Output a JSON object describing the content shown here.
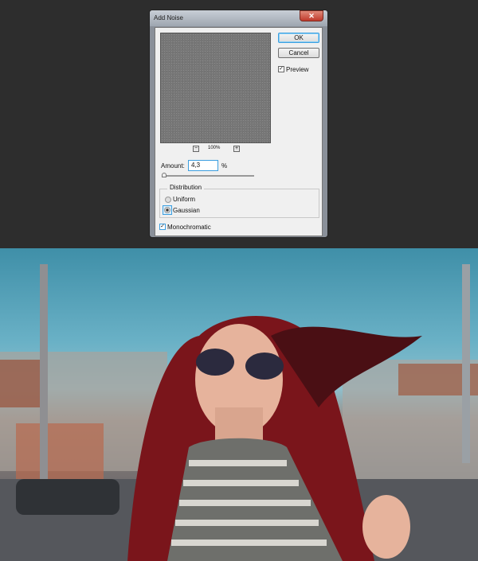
{
  "dialog": {
    "title": "Add Noise",
    "close_icon": "close-icon",
    "ok_label": "OK",
    "cancel_label": "Cancel",
    "preview_label": "Preview",
    "preview_checked": true,
    "zoom_level": "100%",
    "amount_label": "Amount:",
    "amount_value": "4,3",
    "amount_unit": "%",
    "distribution_label": "Distribution",
    "uniform_label": "Uniform",
    "gaussian_label": "Gaussian",
    "selected_distribution": "Gaussian",
    "monochromatic_label": "Monochromatic",
    "monochromatic_checked": true
  },
  "photo": {
    "accent_hair": "#8b1a1f",
    "sky": "#4f9bb3"
  }
}
